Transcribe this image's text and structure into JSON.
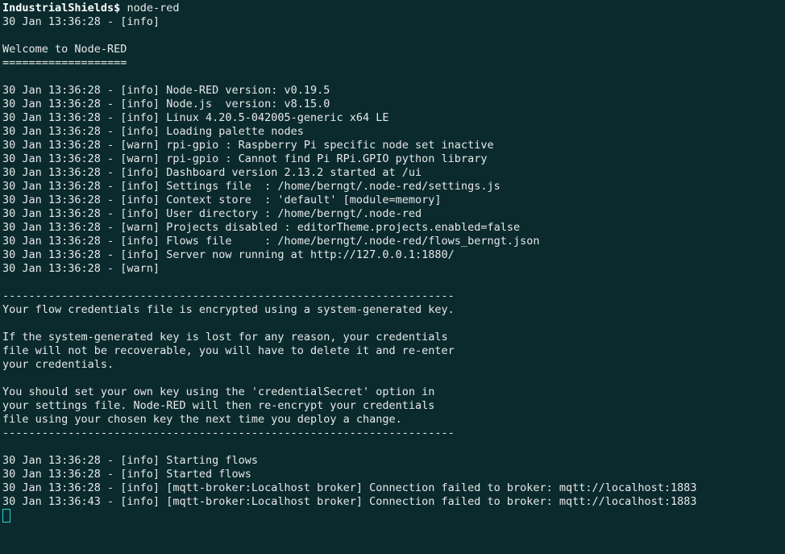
{
  "prompt": {
    "user": "IndustrialShields",
    "sep": "$",
    "cmd": "node-red"
  },
  "lines": [
    "30 Jan 13:36:28 - [info] ",
    "",
    "Welcome to Node-RED",
    "===================",
    "",
    "30 Jan 13:36:28 - [info] Node-RED version: v0.19.5",
    "30 Jan 13:36:28 - [info] Node.js  version: v8.15.0",
    "30 Jan 13:36:28 - [info] Linux 4.20.5-042005-generic x64 LE",
    "30 Jan 13:36:28 - [info] Loading palette nodes",
    "30 Jan 13:36:28 - [warn] rpi-gpio : Raspberry Pi specific node set inactive",
    "30 Jan 13:36:28 - [warn] rpi-gpio : Cannot find Pi RPi.GPIO python library",
    "30 Jan 13:36:28 - [info] Dashboard version 2.13.2 started at /ui",
    "30 Jan 13:36:28 - [info] Settings file  : /home/berngt/.node-red/settings.js",
    "30 Jan 13:36:28 - [info] Context store  : 'default' [module=memory]",
    "30 Jan 13:36:28 - [info] User directory : /home/berngt/.node-red",
    "30 Jan 13:36:28 - [warn] Projects disabled : editorTheme.projects.enabled=false",
    "30 Jan 13:36:28 - [info] Flows file     : /home/berngt/.node-red/flows_berngt.json",
    "30 Jan 13:36:28 - [info] Server now running at http://127.0.0.1:1880/",
    "30 Jan 13:36:28 - [warn] ",
    "",
    "---------------------------------------------------------------------",
    "Your flow credentials file is encrypted using a system-generated key.",
    "",
    "If the system-generated key is lost for any reason, your credentials",
    "file will not be recoverable, you will have to delete it and re-enter",
    "your credentials.",
    "",
    "You should set your own key using the 'credentialSecret' option in",
    "your settings file. Node-RED will then re-encrypt your credentials",
    "file using your chosen key the next time you deploy a change.",
    "---------------------------------------------------------------------",
    "",
    "30 Jan 13:36:28 - [info] Starting flows",
    "30 Jan 13:36:28 - [info] Started flows",
    "30 Jan 13:36:28 - [info] [mqtt-broker:Localhost broker] Connection failed to broker: mqtt://localhost:1883",
    "30 Jan 13:36:43 - [info] [mqtt-broker:Localhost broker] Connection failed to broker: mqtt://localhost:1883"
  ]
}
